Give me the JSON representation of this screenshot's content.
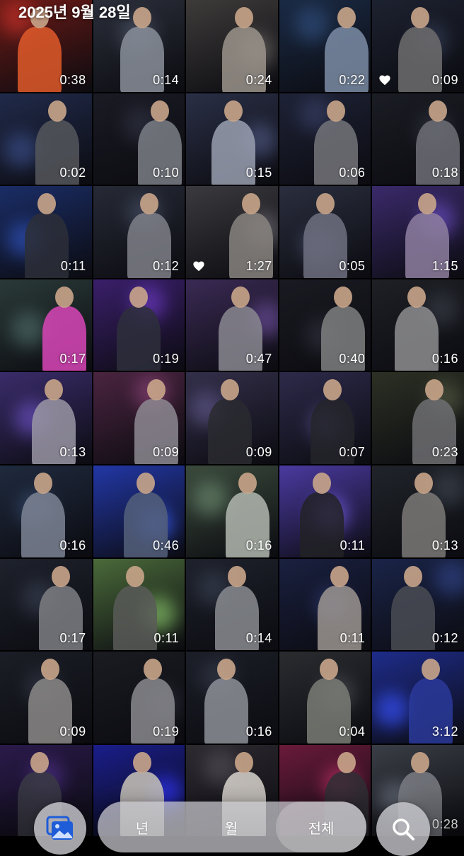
{
  "header": {
    "date": "2025년 9월 28일"
  },
  "grid": {
    "tiles": [
      {
        "duration": "0:38",
        "favorite": false,
        "bg": "#6b1a16",
        "accent": "#e05a2a"
      },
      {
        "duration": "0:14",
        "favorite": false,
        "bg": "#2b2f3a",
        "accent": "#8a8f9a"
      },
      {
        "duration": "0:24",
        "favorite": false,
        "bg": "#3e3b3a",
        "accent": "#9b948c"
      },
      {
        "duration": "0:22",
        "favorite": false,
        "bg": "#1a2a44",
        "accent": "#7d8da6"
      },
      {
        "duration": "0:09",
        "favorite": true,
        "bg": "#1d2230",
        "accent": "#6f6d6e"
      },
      {
        "duration": "0:02",
        "favorite": false,
        "bg": "#202a4a",
        "accent": "#55575c"
      },
      {
        "duration": "0:10",
        "favorite": false,
        "bg": "#1a1b24",
        "accent": "#7b7f86"
      },
      {
        "duration": "0:15",
        "favorite": false,
        "bg": "#2a2f46",
        "accent": "#9aa0b0"
      },
      {
        "duration": "0:06",
        "favorite": false,
        "bg": "#1e2236",
        "accent": "#74747a"
      },
      {
        "duration": "0:18",
        "favorite": false,
        "bg": "#1b1d24",
        "accent": "#6e7077"
      },
      {
        "duration": "0:11",
        "favorite": false,
        "bg": "#1a2d66",
        "accent": "#2d2f38"
      },
      {
        "duration": "0:12",
        "favorite": false,
        "bg": "#262a36",
        "accent": "#7f8088"
      },
      {
        "duration": "1:27",
        "favorite": true,
        "bg": "#3b3a3e",
        "accent": "#888480"
      },
      {
        "duration": "0:05",
        "favorite": false,
        "bg": "#2a2e3e",
        "accent": "#6e7080"
      },
      {
        "duration": "1:15",
        "favorite": false,
        "bg": "#3a2a6a",
        "accent": "#8e7fa0"
      },
      {
        "duration": "0:17",
        "favorite": false,
        "bg": "#2a3a38",
        "accent": "#d946b8"
      },
      {
        "duration": "0:19",
        "favorite": false,
        "bg": "#3a1f6a",
        "accent": "#2e2f3c"
      },
      {
        "duration": "0:47",
        "favorite": false,
        "bg": "#3a2a54",
        "accent": "#8a8890"
      },
      {
        "duration": "0:40",
        "favorite": false,
        "bg": "#1a1a22",
        "accent": "#7f8080"
      },
      {
        "duration": "0:16",
        "favorite": false,
        "bg": "#1e2026",
        "accent": "#8e8e90"
      },
      {
        "duration": "0:13",
        "favorite": false,
        "bg": "#3a2c6a",
        "accent": "#9a97a4"
      },
      {
        "duration": "0:09",
        "favorite": false,
        "bg": "#4a2440",
        "accent": "#8d8a92"
      },
      {
        "duration": "0:09",
        "favorite": false,
        "bg": "#332f4a",
        "accent": "#2a2a30"
      },
      {
        "duration": "0:07",
        "favorite": false,
        "bg": "#2d2a4a",
        "accent": "#24242a"
      },
      {
        "duration": "0:23",
        "favorite": false,
        "bg": "#2c3024",
        "accent": "#6e6e72"
      },
      {
        "duration": "0:16",
        "favorite": false,
        "bg": "#1f2a3e",
        "accent": "#7d8494"
      },
      {
        "duration": "0:46",
        "favorite": false,
        "bg": "#2237a6",
        "accent": "#55607a"
      },
      {
        "duration": "0:16",
        "favorite": false,
        "bg": "#3a4a3c",
        "accent": "#b3b8b0"
      },
      {
        "duration": "0:11",
        "favorite": false,
        "bg": "#4a3aa0",
        "accent": "#222226"
      },
      {
        "duration": "0:13",
        "favorite": false,
        "bg": "#20242a",
        "accent": "#7d7a78"
      },
      {
        "duration": "0:17",
        "favorite": false,
        "bg": "#1e222c",
        "accent": "#7e7f84"
      },
      {
        "duration": "0:11",
        "favorite": false,
        "bg": "#4a6a3a",
        "accent": "#595a58"
      },
      {
        "duration": "0:14",
        "favorite": false,
        "bg": "#1e222c",
        "accent": "#8a8c90"
      },
      {
        "duration": "0:11",
        "favorite": false,
        "bg": "#1a2040",
        "accent": "#9c9590"
      },
      {
        "duration": "0:12",
        "favorite": false,
        "bg": "#1a2448",
        "accent": "#4a4c54"
      },
      {
        "duration": "0:09",
        "favorite": false,
        "bg": "#1b1e26",
        "accent": "#8c8a88"
      },
      {
        "duration": "0:19",
        "favorite": false,
        "bg": "#1a1c22",
        "accent": "#8a8a8e"
      },
      {
        "duration": "0:16",
        "favorite": false,
        "bg": "#1c1f28",
        "accent": "#8e9198"
      },
      {
        "duration": "0:04",
        "favorite": false,
        "bg": "#2a2c30",
        "accent": "#7a7c76"
      },
      {
        "duration": "3:12",
        "favorite": false,
        "bg": "#1e2c8a",
        "accent": "#2a3a9a"
      },
      {
        "duration": "",
        "favorite": false,
        "bg": "#2a1a4a",
        "accent": "#3a3a44"
      },
      {
        "duration": "",
        "favorite": false,
        "bg": "#1a1d8a",
        "accent": "#c9c4b8"
      },
      {
        "duration": "",
        "favorite": false,
        "bg": "#2d2a30",
        "accent": "#d8d4cc"
      },
      {
        "duration": "",
        "favorite": false,
        "bg": "#6a1a3a",
        "accent": "#2e2e34"
      },
      {
        "duration": "0:28",
        "favorite": false,
        "bg": "#3a3e46",
        "accent": "#7a7c82"
      }
    ]
  },
  "toolbar": {
    "library_icon": "photo-library-icon",
    "segments": [
      {
        "label": "년",
        "active": false
      },
      {
        "label": "월",
        "active": false
      },
      {
        "label": "전체",
        "active": true
      }
    ],
    "search_icon": "search-icon"
  },
  "colors": {
    "favorite": "#ffffff",
    "library_icon_blue": "#1e5cd8"
  }
}
